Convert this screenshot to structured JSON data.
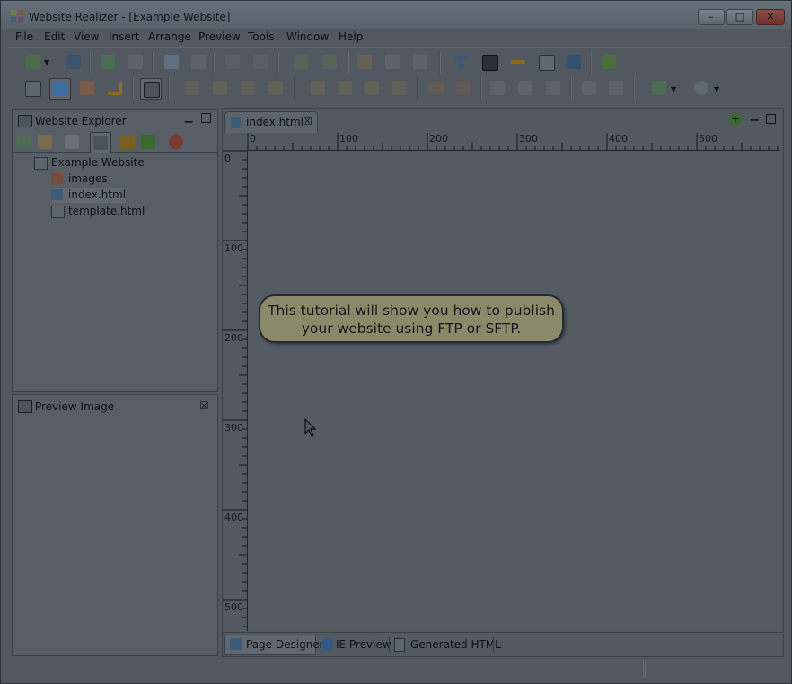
{
  "window": {
    "title": "Website Realizer - [Example Website]",
    "controls": {
      "minimize": "–",
      "maximize": "□",
      "close": "✕"
    }
  },
  "menu": [
    "File",
    "Edit",
    "View",
    "Insert",
    "Arrange",
    "Preview",
    "Tools",
    "Window",
    "Help"
  ],
  "explorer": {
    "title": "Website Explorer",
    "root": "Example Website",
    "items": [
      {
        "label": "images",
        "icon": "folder-icon"
      },
      {
        "label": "index.html",
        "icon": "html-file-icon",
        "selected": true
      },
      {
        "label": "template.html",
        "icon": "template-file-icon"
      }
    ]
  },
  "preview_panel": {
    "title": "Preview Image"
  },
  "editor": {
    "tab_label": "index.html",
    "ruler_h": [
      "0",
      "100",
      "200",
      "300",
      "400",
      "500"
    ],
    "ruler_v": [
      "0",
      "100",
      "200",
      "300",
      "400",
      "500"
    ],
    "callout_line1": "This tutorial will show you how to publish",
    "callout_line2": "your website using FTP or SFTP.",
    "bottom_tabs": [
      "Page Designer",
      "IE Preview",
      "Generated HTML"
    ]
  },
  "colors": {
    "overlay": "#545b63",
    "callout": "#8a8a6a",
    "accent_blue": "#3d6ea8"
  }
}
